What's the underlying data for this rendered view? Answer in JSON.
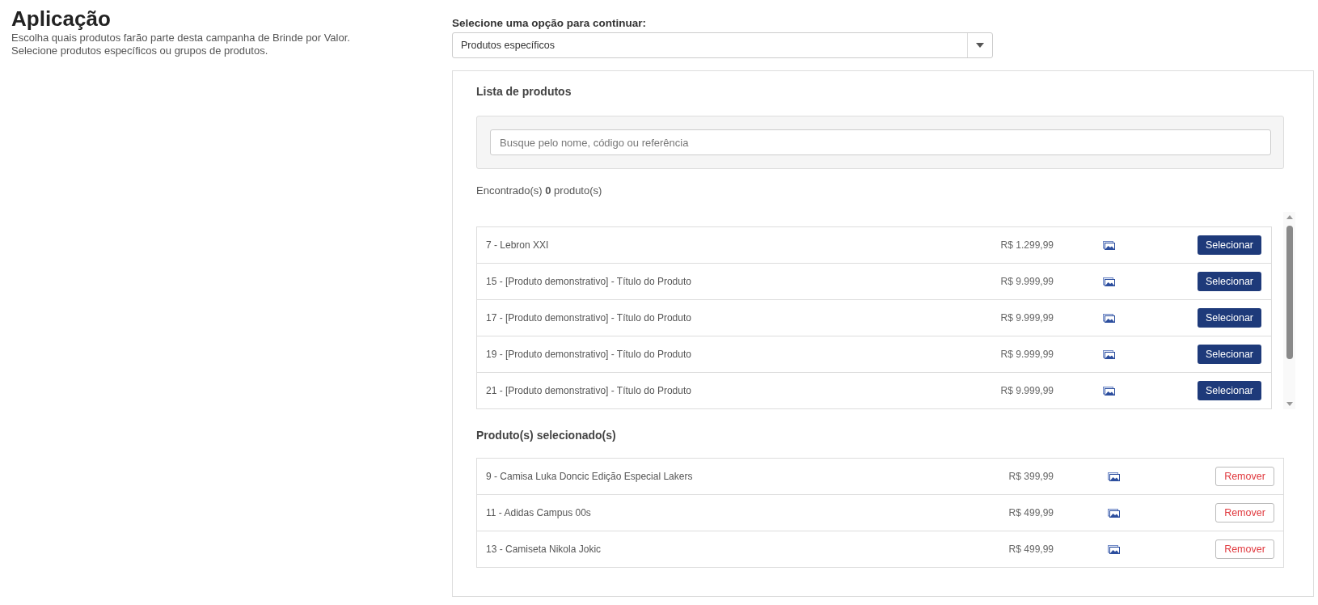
{
  "header": {
    "title": "Aplicação",
    "description": [
      "Escolha quais produtos farão parte desta campanha de Brinde por Valor.",
      "Selecione produtos específicos ou grupos de produtos."
    ]
  },
  "option_select": {
    "label": "Selecione uma opção para continuar:",
    "value": "Produtos específicos"
  },
  "product_list": {
    "title": "Lista de produtos",
    "search": {
      "placeholder": "Busque pelo nome, código ou referência"
    },
    "result_count": "Encontrado(s) **0** produto(s)",
    "rows": [
      {
        "name": "7 - Lebron XXI",
        "price": "R$ 1.299,99",
        "action": "Selecionar"
      },
      {
        "name": "15 - [Produto demonstrativo] - Título do Produto",
        "price": "R$ 9.999,99",
        "action": "Selecionar"
      },
      {
        "name": "17 - [Produto demonstrativo] - Título do Produto",
        "price": "R$ 9.999,99",
        "action": "Selecionar"
      },
      {
        "name": "19 - [Produto demonstrativo] - Título do Produto",
        "price": "R$ 9.999,99",
        "action": "Selecionar"
      },
      {
        "name": "21 - [Produto demonstrativo] - Título do Produto",
        "price": "R$ 9.999,99",
        "action": "Selecionar"
      }
    ]
  },
  "selected_products": {
    "title": "Produto(s) selecionado(s)",
    "rows": [
      {
        "name": "9 - Camisa Luka Doncic Edição Especial Lakers",
        "price": "R$ 399,99",
        "action": "Remover"
      },
      {
        "name": "11 - Adidas Campus 00s",
        "price": "R$ 499,99",
        "action": "Remover"
      },
      {
        "name": "13 - Camiseta Nikola Jokic",
        "price": "R$ 499,99",
        "action": "Remover"
      }
    ]
  }
}
